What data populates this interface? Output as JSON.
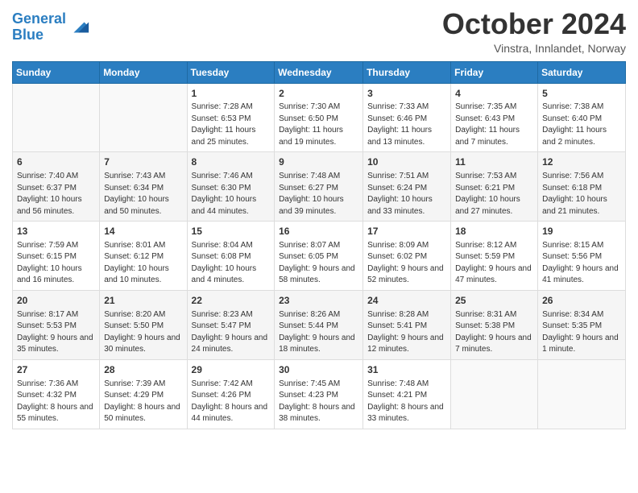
{
  "header": {
    "logo_line1": "General",
    "logo_line2": "Blue",
    "month_title": "October 2024",
    "subtitle": "Vinstra, Innlandet, Norway"
  },
  "days_of_week": [
    "Sunday",
    "Monday",
    "Tuesday",
    "Wednesday",
    "Thursday",
    "Friday",
    "Saturday"
  ],
  "weeks": [
    [
      {
        "day": "",
        "info": ""
      },
      {
        "day": "",
        "info": ""
      },
      {
        "day": "1",
        "info": "Sunrise: 7:28 AM\nSunset: 6:53 PM\nDaylight: 11 hours and 25 minutes."
      },
      {
        "day": "2",
        "info": "Sunrise: 7:30 AM\nSunset: 6:50 PM\nDaylight: 11 hours and 19 minutes."
      },
      {
        "day": "3",
        "info": "Sunrise: 7:33 AM\nSunset: 6:46 PM\nDaylight: 11 hours and 13 minutes."
      },
      {
        "day": "4",
        "info": "Sunrise: 7:35 AM\nSunset: 6:43 PM\nDaylight: 11 hours and 7 minutes."
      },
      {
        "day": "5",
        "info": "Sunrise: 7:38 AM\nSunset: 6:40 PM\nDaylight: 11 hours and 2 minutes."
      }
    ],
    [
      {
        "day": "6",
        "info": "Sunrise: 7:40 AM\nSunset: 6:37 PM\nDaylight: 10 hours and 56 minutes."
      },
      {
        "day": "7",
        "info": "Sunrise: 7:43 AM\nSunset: 6:34 PM\nDaylight: 10 hours and 50 minutes."
      },
      {
        "day": "8",
        "info": "Sunrise: 7:46 AM\nSunset: 6:30 PM\nDaylight: 10 hours and 44 minutes."
      },
      {
        "day": "9",
        "info": "Sunrise: 7:48 AM\nSunset: 6:27 PM\nDaylight: 10 hours and 39 minutes."
      },
      {
        "day": "10",
        "info": "Sunrise: 7:51 AM\nSunset: 6:24 PM\nDaylight: 10 hours and 33 minutes."
      },
      {
        "day": "11",
        "info": "Sunrise: 7:53 AM\nSunset: 6:21 PM\nDaylight: 10 hours and 27 minutes."
      },
      {
        "day": "12",
        "info": "Sunrise: 7:56 AM\nSunset: 6:18 PM\nDaylight: 10 hours and 21 minutes."
      }
    ],
    [
      {
        "day": "13",
        "info": "Sunrise: 7:59 AM\nSunset: 6:15 PM\nDaylight: 10 hours and 16 minutes."
      },
      {
        "day": "14",
        "info": "Sunrise: 8:01 AM\nSunset: 6:12 PM\nDaylight: 10 hours and 10 minutes."
      },
      {
        "day": "15",
        "info": "Sunrise: 8:04 AM\nSunset: 6:08 PM\nDaylight: 10 hours and 4 minutes."
      },
      {
        "day": "16",
        "info": "Sunrise: 8:07 AM\nSunset: 6:05 PM\nDaylight: 9 hours and 58 minutes."
      },
      {
        "day": "17",
        "info": "Sunrise: 8:09 AM\nSunset: 6:02 PM\nDaylight: 9 hours and 52 minutes."
      },
      {
        "day": "18",
        "info": "Sunrise: 8:12 AM\nSunset: 5:59 PM\nDaylight: 9 hours and 47 minutes."
      },
      {
        "day": "19",
        "info": "Sunrise: 8:15 AM\nSunset: 5:56 PM\nDaylight: 9 hours and 41 minutes."
      }
    ],
    [
      {
        "day": "20",
        "info": "Sunrise: 8:17 AM\nSunset: 5:53 PM\nDaylight: 9 hours and 35 minutes."
      },
      {
        "day": "21",
        "info": "Sunrise: 8:20 AM\nSunset: 5:50 PM\nDaylight: 9 hours and 30 minutes."
      },
      {
        "day": "22",
        "info": "Sunrise: 8:23 AM\nSunset: 5:47 PM\nDaylight: 9 hours and 24 minutes."
      },
      {
        "day": "23",
        "info": "Sunrise: 8:26 AM\nSunset: 5:44 PM\nDaylight: 9 hours and 18 minutes."
      },
      {
        "day": "24",
        "info": "Sunrise: 8:28 AM\nSunset: 5:41 PM\nDaylight: 9 hours and 12 minutes."
      },
      {
        "day": "25",
        "info": "Sunrise: 8:31 AM\nSunset: 5:38 PM\nDaylight: 9 hours and 7 minutes."
      },
      {
        "day": "26",
        "info": "Sunrise: 8:34 AM\nSunset: 5:35 PM\nDaylight: 9 hours and 1 minute."
      }
    ],
    [
      {
        "day": "27",
        "info": "Sunrise: 7:36 AM\nSunset: 4:32 PM\nDaylight: 8 hours and 55 minutes."
      },
      {
        "day": "28",
        "info": "Sunrise: 7:39 AM\nSunset: 4:29 PM\nDaylight: 8 hours and 50 minutes."
      },
      {
        "day": "29",
        "info": "Sunrise: 7:42 AM\nSunset: 4:26 PM\nDaylight: 8 hours and 44 minutes."
      },
      {
        "day": "30",
        "info": "Sunrise: 7:45 AM\nSunset: 4:23 PM\nDaylight: 8 hours and 38 minutes."
      },
      {
        "day": "31",
        "info": "Sunrise: 7:48 AM\nSunset: 4:21 PM\nDaylight: 8 hours and 33 minutes."
      },
      {
        "day": "",
        "info": ""
      },
      {
        "day": "",
        "info": ""
      }
    ]
  ]
}
